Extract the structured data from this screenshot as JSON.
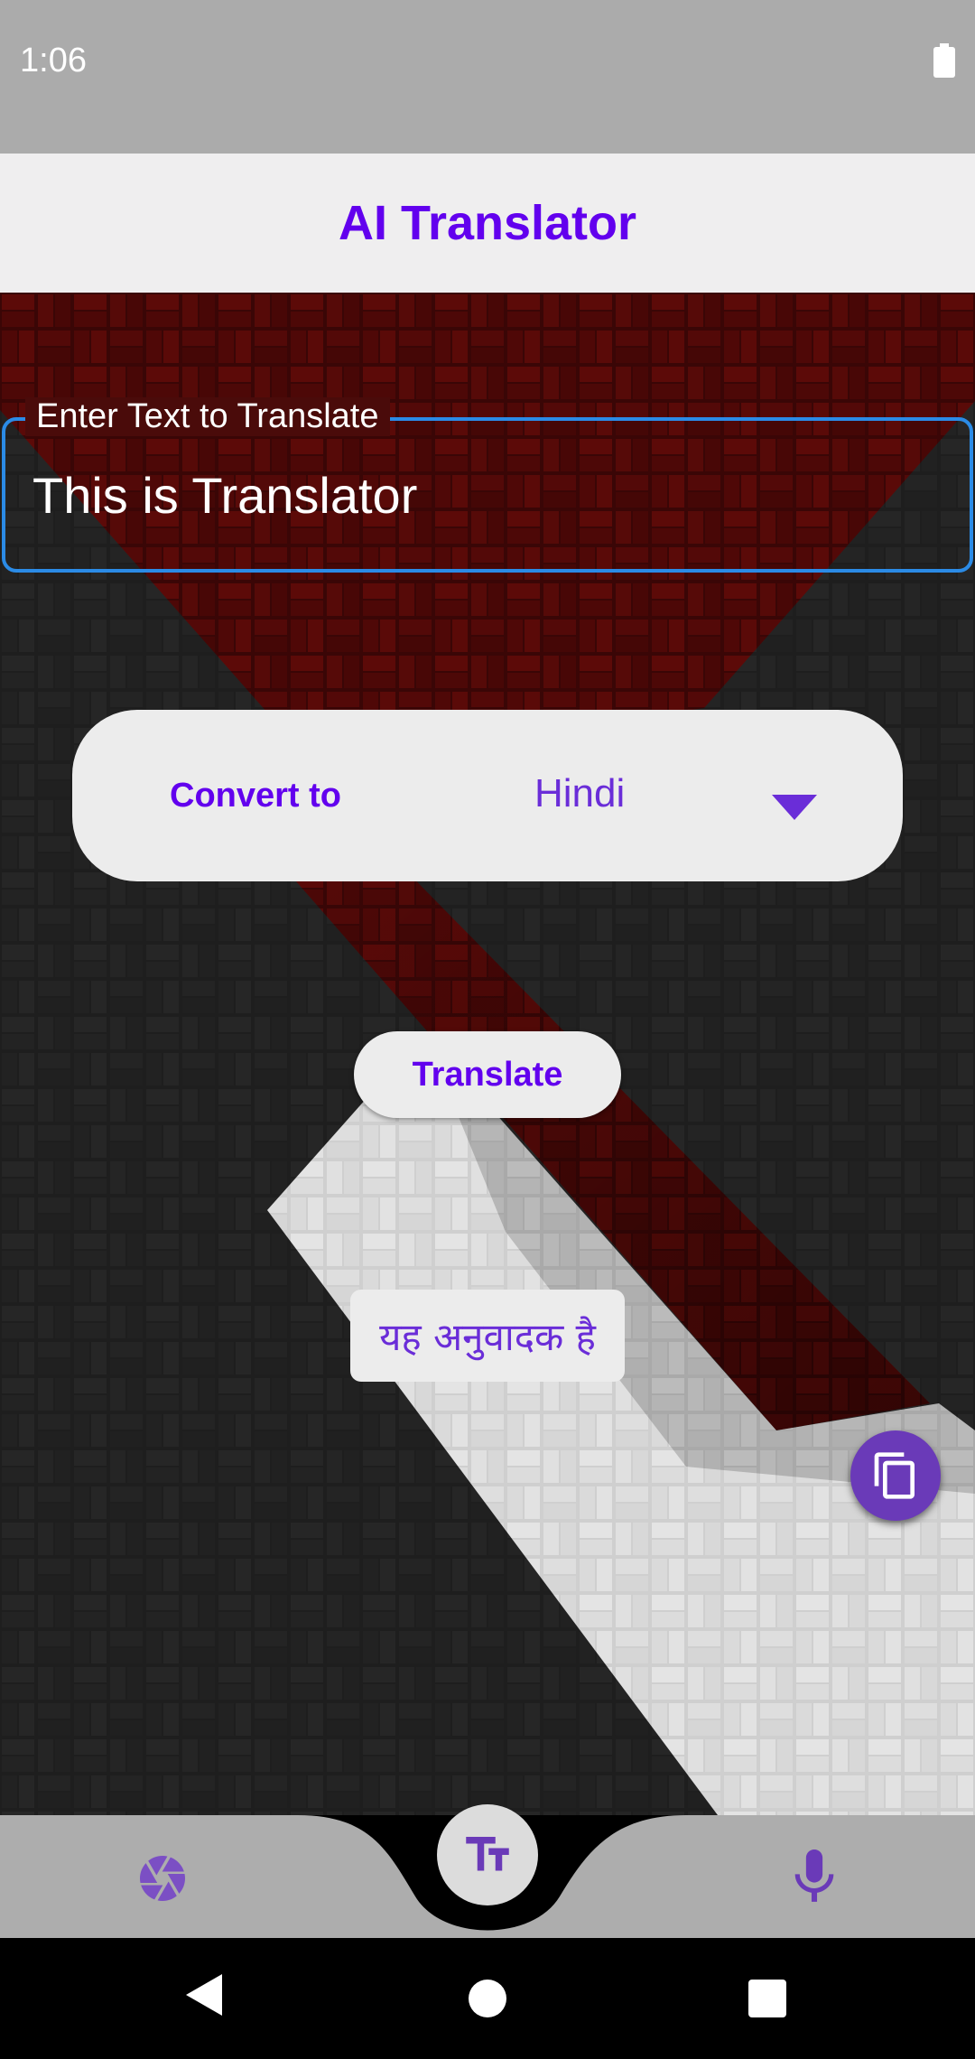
{
  "status_bar": {
    "time": "1:06",
    "battery_icon": "battery-full-icon"
  },
  "app_bar": {
    "title": "AI Translator"
  },
  "input": {
    "label": "Enter Text to Translate",
    "value": "This is Translator"
  },
  "convert": {
    "label": "Convert to",
    "selected_language": "Hindi",
    "dropdown_icon": "chevron-down-icon"
  },
  "translate_button": {
    "label": "Translate"
  },
  "result": {
    "text": "यह अनुवादक है"
  },
  "copy_button": {
    "icon": "copy-icon"
  },
  "bottom_nav": {
    "camera_icon": "camera-aperture-icon",
    "text_icon": "text-size-icon",
    "mic_icon": "microphone-icon"
  },
  "system_nav": {
    "back_icon": "back-icon",
    "home_icon": "home-icon",
    "recents_icon": "recents-icon"
  },
  "colors": {
    "accent": "#6200ee",
    "fab": "#6a3ab8",
    "outline": "#2b8be6",
    "card": "#ececec",
    "app_bar": "#efeeef",
    "status_bar": "#ababab"
  }
}
